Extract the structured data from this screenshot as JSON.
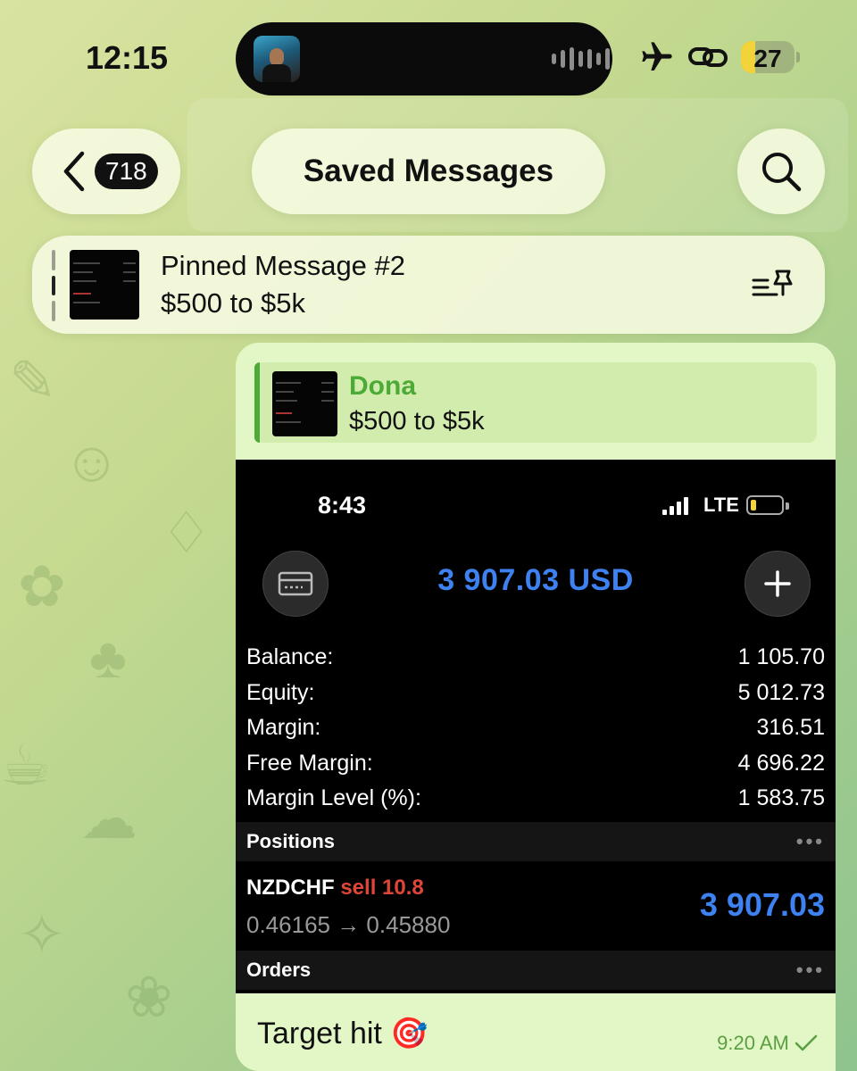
{
  "status_bar": {
    "time": "12:15",
    "battery": "27",
    "battery_level": 0.27,
    "icons": [
      "album-art-icon",
      "audio-wave-icon",
      "airplane-icon",
      "link-icon",
      "battery-icon"
    ]
  },
  "nav": {
    "back_count": "718",
    "title": "Saved Messages",
    "icons": [
      "chevron-left-icon",
      "search-icon"
    ]
  },
  "pinned": {
    "title": "Pinned Message #2",
    "text": "$500 to $5k",
    "icon": "pinned-list-icon"
  },
  "message": {
    "reply": {
      "name": "Dona",
      "text": "$500 to $5k"
    },
    "screenshot": {
      "time": "8:43",
      "network": "LTE",
      "total": "3 907.03 USD",
      "account": [
        {
          "label": "Balance:",
          "value": "1 105.70"
        },
        {
          "label": "Equity:",
          "value": "5 012.73"
        },
        {
          "label": "Margin:",
          "value": "316.51"
        },
        {
          "label": "Free Margin:",
          "value": "4 696.22"
        },
        {
          "label": "Margin Level (%):",
          "value": "1 583.75"
        }
      ],
      "positions_label": "Positions",
      "position": {
        "symbol": "NZDCHF",
        "side": "sell 10.8",
        "rate": "0.46165 → 0.45880",
        "profit": "3 907.03"
      },
      "orders_label": "Orders",
      "dots": "•••"
    },
    "caption": "Target hit 🎯",
    "time": "9:20 AM",
    "colors": {
      "accent_green": "#4caa37",
      "profit_blue": "#3d82f0",
      "sell_red": "#e0453a"
    }
  }
}
